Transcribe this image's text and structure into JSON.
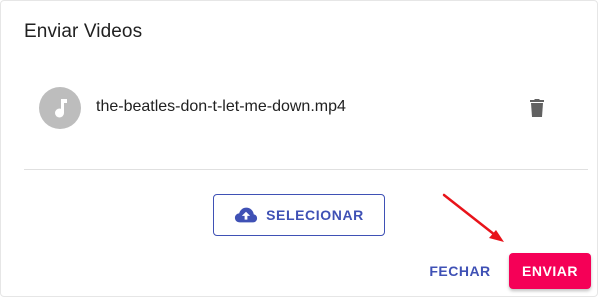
{
  "dialog": {
    "title": "Enviar Videos"
  },
  "file": {
    "name": "the-beatles-don-t-let-me-down.mp4",
    "avatar_icon": "music-note-icon",
    "delete_icon": "trash-icon"
  },
  "upload": {
    "label": "SELECIONAR",
    "icon": "cloud-upload-icon"
  },
  "actions": {
    "close_label": "FECHAR",
    "send_label": "ENVIAR"
  },
  "colors": {
    "primary": "#3f51b5",
    "secondary": "#f50057",
    "annotation": "#e8131a",
    "avatar_bg": "#bdbdbd"
  }
}
